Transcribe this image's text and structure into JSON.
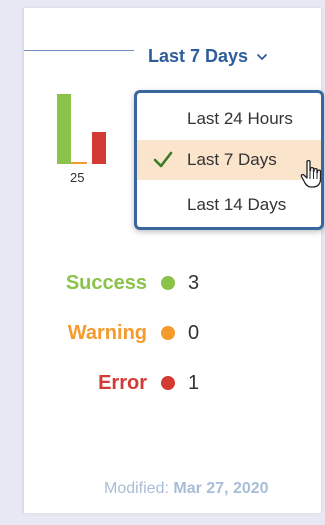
{
  "period_selector": {
    "label": "Last 7 Days",
    "icon": "chevron-down-icon"
  },
  "mini_chart": {
    "count_label": "25",
    "bars": [
      {
        "status": "Success",
        "color": "#8bc34a"
      },
      {
        "status": "Warning",
        "color": "#f59a2c"
      },
      {
        "status": "Error",
        "color": "#d43a34"
      }
    ]
  },
  "dropdown": {
    "items": [
      {
        "label": "Last 24 Hours",
        "selected": false
      },
      {
        "label": "Last 7 Days",
        "selected": true
      },
      {
        "label": "Last 14 Days",
        "selected": false
      }
    ],
    "selected_bg": "#fbe4cc",
    "border_color": "#3c669e"
  },
  "legend": [
    {
      "name": "Success",
      "count": "3",
      "color": "#8bc34a"
    },
    {
      "name": "Warning",
      "count": "0",
      "color": "#f59a2c"
    },
    {
      "name": "Error",
      "count": "1",
      "color": "#d43a34"
    }
  ],
  "modified": {
    "prefix": "Modified:",
    "date": "Mar 27, 2020"
  }
}
